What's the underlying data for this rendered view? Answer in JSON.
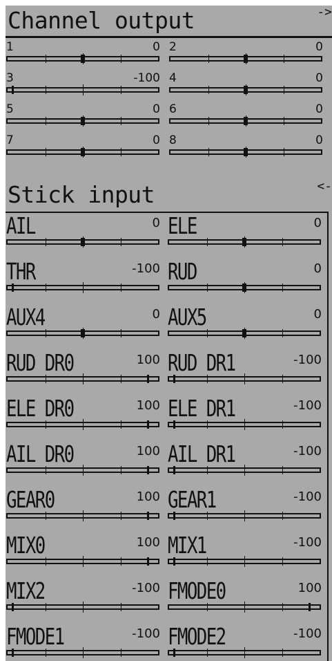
{
  "channel_output": {
    "title": "Channel output",
    "nav": "->",
    "channels": [
      {
        "label": "1",
        "value": "0",
        "level": 0
      },
      {
        "label": "2",
        "value": "0",
        "level": 0
      },
      {
        "label": "3",
        "value": "-100",
        "level": -100
      },
      {
        "label": "4",
        "value": "0",
        "level": 0
      },
      {
        "label": "5",
        "value": "0",
        "level": 0
      },
      {
        "label": "6",
        "value": "0",
        "level": 0
      },
      {
        "label": "7",
        "value": "0",
        "level": 0
      },
      {
        "label": "8",
        "value": "0",
        "level": 0
      }
    ]
  },
  "stick_input": {
    "title": "Stick input",
    "nav": "<-",
    "inputs": [
      {
        "label": "AIL",
        "value": "0",
        "level": 0
      },
      {
        "label": "ELE",
        "value": "0",
        "level": 0
      },
      {
        "label": "THR",
        "value": "-100",
        "level": -100
      },
      {
        "label": "RUD",
        "value": "0",
        "level": 0
      },
      {
        "label": "AUX4",
        "value": "0",
        "level": 0
      },
      {
        "label": "AUX5",
        "value": "0",
        "level": 0
      },
      {
        "label": "RUD DR0",
        "value": "100",
        "level": 100
      },
      {
        "label": "RUD DR1",
        "value": "-100",
        "level": -100
      },
      {
        "label": "ELE DR0",
        "value": "100",
        "level": 100
      },
      {
        "label": "ELE DR1",
        "value": "-100",
        "level": -100
      },
      {
        "label": "AIL DR0",
        "value": "100",
        "level": 100
      },
      {
        "label": "AIL DR1",
        "value": "-100",
        "level": -100
      },
      {
        "label": "GEAR0",
        "value": "100",
        "level": 100
      },
      {
        "label": "GEAR1",
        "value": "-100",
        "level": -100
      },
      {
        "label": "MIX0",
        "value": "100",
        "level": 100
      },
      {
        "label": "MIX1",
        "value": "-100",
        "level": -100
      },
      {
        "label": "MIX2",
        "value": "-100",
        "level": -100
      },
      {
        "label": "FMODE0",
        "value": "100",
        "level": 100
      },
      {
        "label": "FMODE1",
        "value": "-100",
        "level": -100
      },
      {
        "label": "FMODE2",
        "value": "-100",
        "level": -100
      }
    ]
  },
  "colors": {
    "screen_bg": "#a9a9a9",
    "ink": "#111111"
  }
}
